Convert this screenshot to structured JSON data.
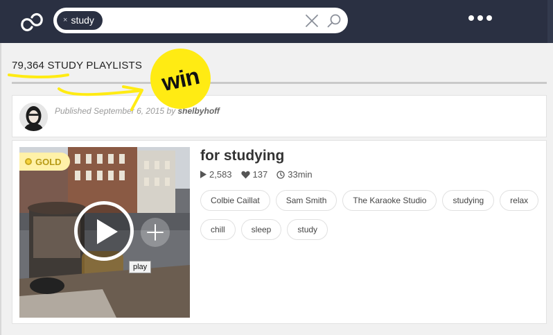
{
  "header": {
    "search_chip": "study",
    "search_chip_close": "×"
  },
  "results": {
    "count_label": "79,364 STUDY PLAYLISTS"
  },
  "publication": {
    "text": "Published September 6, 2015 by",
    "author": "shelbyhoff"
  },
  "playlist": {
    "badge": "GOLD",
    "title": "for studying",
    "plays": "2,583",
    "likes": "137",
    "duration": "33min",
    "play_tooltip": "play",
    "tags": [
      "Colbie Caillat",
      "Sam Smith",
      "The Karaoke Studio",
      "studying",
      "relax",
      "chill",
      "sleep",
      "study"
    ]
  },
  "annotation": {
    "badge_text": "win",
    "highlight_color": "#ffeb13"
  },
  "colors": {
    "header_bg": "#2a3042",
    "gold_badge_bg": "#fff1a8",
    "gold_badge_text": "#b79a16"
  }
}
